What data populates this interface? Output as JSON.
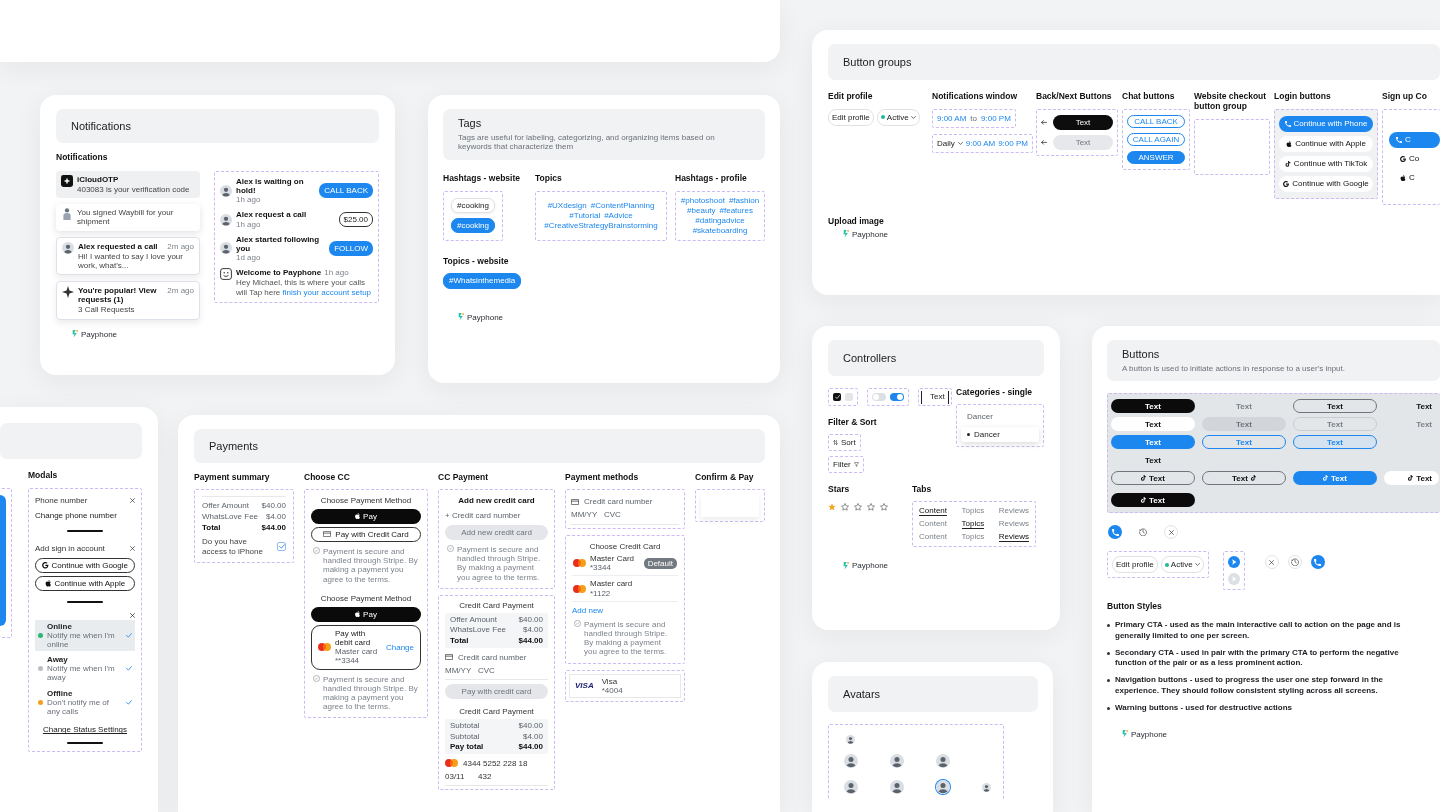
{
  "notifications_card": {
    "header": "Notifications",
    "section_title": "Notifications",
    "toasts": [
      {
        "kind": "otp",
        "title": "iCloudOTP",
        "body": "403083 is your verification code"
      },
      {
        "kind": "shipment",
        "body": "You signed Waybill for your shipment"
      },
      {
        "kind": "call",
        "title": "Alex requested a call",
        "time": "2m ago",
        "body": "Hi! I wanted to say I love your work, what's..."
      },
      {
        "kind": "popular",
        "title": "You're popular! View requests (1)",
        "time": "2m ago",
        "body": "3 Call Requests"
      }
    ],
    "feed": [
      {
        "kind": "primary_action",
        "text": "Alex is waiting on hold!",
        "time": "1h ago",
        "action": "CALL BACK"
      },
      {
        "kind": "outline_action",
        "text": "Alex request a call",
        "time": "1h ago",
        "action": "$25.00"
      },
      {
        "kind": "primary_action",
        "text": "Alex started following you",
        "time": "1d ago",
        "action": "FOLLOW"
      },
      {
        "kind": "welcome",
        "title": "Welcome to Payphone",
        "time": "1h ago",
        "body": "Hey Michael, this is where your calls will",
        "link_prefix": "Tap here",
        "link": "finish your account setup"
      }
    ],
    "brand": "Payphone"
  },
  "tags_card": {
    "header": "Tags",
    "subtitle": "Tags are useful for labeling, categorizing, and organizing items based on keywords that characterize them",
    "groups": [
      {
        "title": "Hashtags - website",
        "kind": "stack",
        "tags": [
          {
            "label": "#cooking",
            "selected": false
          },
          {
            "label": "#cooking",
            "selected": true
          }
        ]
      },
      {
        "title": "Topics",
        "kind": "cloud",
        "tags": [
          "#UXdesign",
          "#ContentPlanning",
          "#Tutorial",
          "#Advice",
          "#CreativeStrategyBrainstorming"
        ]
      },
      {
        "title": "Hashtags - profile",
        "kind": "cloud",
        "tags": [
          "#photoshoot",
          "#fashion",
          "#beauty",
          "#features",
          "#datingadvice",
          "#skateboarding"
        ]
      }
    ],
    "topics_website": {
      "title": "Topics - website",
      "tags": [
        "#Whatsinthemedia"
      ]
    },
    "brand": "Payphone"
  },
  "button_groups_card": {
    "header": "Button groups",
    "groups": [
      {
        "title": "Edit profile",
        "kind": "edit_profile",
        "button": "Edit profile",
        "status": "Active"
      },
      {
        "title": "Notifications window",
        "kind": "time_window",
        "rows": [
          {
            "from": "9:00 AM",
            "to_label": "to",
            "to": "9:00 PM"
          },
          {
            "prefix": "Daily",
            "from": "9:00 AM",
            "to": "9:00 PM"
          }
        ]
      },
      {
        "title": "Back/Next Buttons",
        "kind": "back_next",
        "buttons": [
          {
            "label": "Text",
            "disabled": false
          },
          {
            "label": "Text",
            "disabled": true
          }
        ]
      },
      {
        "title": "Chat buttons",
        "kind": "chat",
        "buttons": [
          {
            "label": "CALL BACK",
            "kind": "outline"
          },
          {
            "label": "CALL AGAIN",
            "kind": "outline"
          },
          {
            "label": "ANSWER",
            "kind": "primary"
          }
        ]
      },
      {
        "title": "Website checkout button group",
        "kind": "empty"
      },
      {
        "title": "Login buttons",
        "kind": "login",
        "buttons": [
          {
            "label": "Continue with Phone",
            "kind": "phone"
          },
          {
            "label": "Continue with Apple",
            "kind": "apple"
          },
          {
            "label": "Continue with TikTok",
            "kind": "tiktok"
          },
          {
            "label": "Continue with Google",
            "kind": "google"
          }
        ]
      },
      {
        "title": "Sign up Co",
        "kind": "signup",
        "buttons": [
          {
            "label": "C",
            "kind": "phone"
          },
          {
            "label": "Co",
            "kind": "google"
          },
          {
            "label": "C",
            "kind": "apple"
          }
        ]
      }
    ],
    "upload_label": "Upload image",
    "brand": "Payphone"
  },
  "modals_card": {
    "title": "Modals",
    "phone_sheet": {
      "title": "Phone number",
      "item": "Change phone number"
    },
    "signin_sheet": {
      "title": "Add sign in account",
      "buttons": [
        {
          "label": "Continue with Google",
          "kind": "google"
        },
        {
          "label": "Continue with Apple",
          "kind": "apple"
        }
      ]
    },
    "status_sheet": {
      "statuses": [
        {
          "label": "Online",
          "note": "Notify me when I'm online",
          "color": "#2bb673",
          "selected": true
        },
        {
          "label": "Away",
          "note": "Notify me when I'm away",
          "color": "#b9bec4",
          "selected": false
        },
        {
          "label": "Offline",
          "note": "Don't notify me of any calls",
          "color": "#f0a020",
          "selected": false
        }
      ],
      "link": "Change Status Settings"
    }
  },
  "payments_card": {
    "header": "Payments",
    "columns": [
      {
        "title": "Payment summary",
        "kind": "summary",
        "rows": [
          {
            "label": "Offer Amount",
            "value": "$40.00",
            "total": false
          },
          {
            "label": "WhatsLove Fee",
            "value": "$4.00",
            "total": false
          },
          {
            "label": "Total",
            "value": "$44.00",
            "total": true
          }
        ],
        "question": "Do you have access to iPhone",
        "checked": true
      },
      {
        "title": "Choose CC",
        "kind": "choose_cc",
        "blocks": [
          {
            "heading": "Choose Payment Method",
            "wallet_label": "Pay",
            "option": {
              "kind": "card_button",
              "label": "Pay with Credit Card"
            },
            "note": "Payment is secure and handled through Stripe. By making a payment you agree to the terms."
          },
          {
            "heading": "Choose Payment Method",
            "wallet_label": "Pay",
            "option": {
              "kind": "saved_card",
              "label": "Pay with debit card",
              "detail": "Master card **3344",
              "action": "Change"
            },
            "note": "Payment is secure and handled through Stripe. By making a payment you agree to the terms."
          }
        ]
      },
      {
        "title": "CC Payment",
        "kind": "cc_payment",
        "add_card": {
          "heading": "Add new credit card",
          "placeholder": "+ Credit card number",
          "button": {
            "label": "Add new credit card",
            "disabled": true
          },
          "note": "Payment is secure and handled through Stripe. By making a payment you agree to the terms."
        },
        "sections": [
          {
            "heading": "Credit Card Payment",
            "rows": [
              {
                "label": "Offer Amount",
                "value": "$40.00",
                "total": false
              },
              {
                "label": "WhatsLove Fee",
                "value": "$4.00",
                "total": false
              },
              {
                "label": "Total",
                "value": "$44.00",
                "total": true
              }
            ],
            "card": {
              "kind": "empty",
              "fields": [
                {
                  "placeholder": "Credit card number"
                },
                {
                  "placeholder": "MM/YY"
                },
                {
                  "placeholder": "CVC"
                }
              ]
            },
            "button": {
              "label": "Pay with credit card",
              "disabled": true
            }
          },
          {
            "heading": "Credit Card Payment",
            "rows": [
              {
                "label": "Subtotal",
                "value": "$40.00",
                "total": false
              },
              {
                "label": "Subtotal",
                "value": "$4.00",
                "total": false
              },
              {
                "label": "Pay total",
                "value": "$44.00",
                "total": true
              }
            ],
            "card": {
              "kind": "filled",
              "fields": [
                {
                  "value": "4344 5252 228 18"
                },
                {
                  "value": "03/11"
                },
                {
                  "value": "432"
                }
              ]
            }
          }
        ]
      },
      {
        "title": "Payment methods",
        "kind": "methods",
        "card": {
          "kind": "empty",
          "fields": [
            {
              "placeholder": "Credit card number"
            },
            {
              "placeholder": "MM/YY"
            },
            {
              "placeholder": "CVC"
            }
          ]
        },
        "chooser": {
          "heading": "Choose Credit Card",
          "cards": [
            {
              "name": "Master Card",
              "number": "*3344",
              "badge": "Default"
            },
            {
              "name": "Master card",
              "number": "*1122"
            }
          ],
          "add": "Add new",
          "note": "Payment is secure and handled through Stripe. By making a payment you agree to the terms."
        },
        "saved": {
          "logo": "VISA",
          "name": "Visa",
          "number": "*4004"
        }
      },
      {
        "title": "Confirm & Pay",
        "kind": "confirm"
      }
    ]
  },
  "controllers_card": {
    "header": "Controllers",
    "checkboxes": [
      {
        "checked": true
      },
      {
        "checked": false
      }
    ],
    "toggles": [
      {
        "on": false
      },
      {
        "on": true
      }
    ],
    "text_field": {
      "value": "Text"
    },
    "categories": {
      "title": "Categories - single",
      "options": [
        {
          "label": "Dancer",
          "selected": false
        },
        {
          "label": "Dancer",
          "selected": true
        }
      ]
    },
    "filter_sort": {
      "title": "Filter & Sort",
      "buttons": [
        {
          "label": "Sort",
          "kind": "sort"
        },
        {
          "label": "Filter",
          "kind": "filter"
        }
      ]
    },
    "stars": {
      "title": "Stars",
      "stars": 1
    },
    "tabs": {
      "title": "Tabs",
      "rows": [
        [
          {
            "label": "Content",
            "selected": true
          },
          {
            "label": "Topics",
            "selected": false
          },
          {
            "label": "Reviews",
            "selected": false
          }
        ],
        [
          {
            "label": "Content",
            "selected": false
          },
          {
            "label": "Topics",
            "selected": true
          },
          {
            "label": "Reviews",
            "selected": false
          }
        ],
        [
          {
            "label": "Content",
            "selected": false
          },
          {
            "label": "Topics",
            "selected": false
          },
          {
            "label": "Reviews",
            "selected": true
          }
        ]
      ]
    },
    "brand": "Payphone"
  },
  "buttons_card": {
    "header": "Buttons",
    "subtitle": "A button is used to initiate actions in response to a user's input.",
    "grid": [
      [
        {
          "label": "Text",
          "kind": "dark"
        },
        {
          "label": "Text",
          "kind": "faint"
        },
        {
          "label": "Text",
          "kind": "outline"
        },
        {
          "label": "Text",
          "kind": "plain"
        }
      ],
      [
        {
          "label": "Text",
          "kind": "light"
        },
        {
          "label": "Text",
          "kind": "disabled"
        },
        {
          "label": "Text",
          "kind": "disabled_outline"
        },
        {
          "label": "Text",
          "kind": "faint"
        }
      ],
      [
        {
          "label": "Text",
          "kind": "primary"
        },
        {
          "label": "Text",
          "kind": "outline_primary"
        },
        {
          "label": "Text",
          "kind": "tinted"
        }
      ],
      [
        {
          "label": "Text",
          "kind": "plain"
        }
      ],
      [
        {
          "label": "Text",
          "kind": "outline_icon"
        },
        {
          "label": "Text",
          "kind": "outline_icon_end"
        },
        {
          "label": "Text",
          "kind": "primary_icon"
        },
        {
          "label": "Text",
          "kind": "light_icon"
        }
      ],
      [
        {
          "label": "Text",
          "kind": "dark_icon"
        }
      ]
    ],
    "icon_buttons": [
      {
        "kind": "call"
      },
      {
        "kind": "history"
      },
      {
        "kind": "close_soft"
      }
    ],
    "edit_profile": {
      "button": "Edit profile",
      "status": "Active"
    },
    "send_buttons": [
      {
        "disabled": false
      },
      {
        "disabled": true
      }
    ],
    "icon_buttons_2": [
      {
        "kind": "close_soft"
      },
      {
        "kind": "history_soft"
      },
      {
        "kind": "call"
      }
    ],
    "styles": {
      "title": "Button Styles",
      "items": [
        "Primary CTA - used as the main interactive call to action on the page and is generally limited to one per screen.",
        "Secondary CTA - used in pair with the primary CTA to perform the negative function of the pair or as a less prominent action.",
        "Navigation buttons - used to progress the user one step forward in the experience. They should follow consistent styling across all screens.",
        "Warning buttons - used for destructive actions"
      ]
    },
    "brand": "Payphone"
  },
  "avatars_card": {
    "header": "Avatars",
    "rows": [
      [
        {
          "kind": "small"
        }
      ],
      [
        {
          "kind": "medium"
        },
        {
          "kind": "medium"
        },
        {
          "kind": "medium"
        }
      ],
      [
        {
          "kind": "medium"
        },
        {
          "kind": "medium"
        },
        {
          "kind": "ringed"
        },
        {
          "kind": "small"
        }
      ]
    ]
  }
}
